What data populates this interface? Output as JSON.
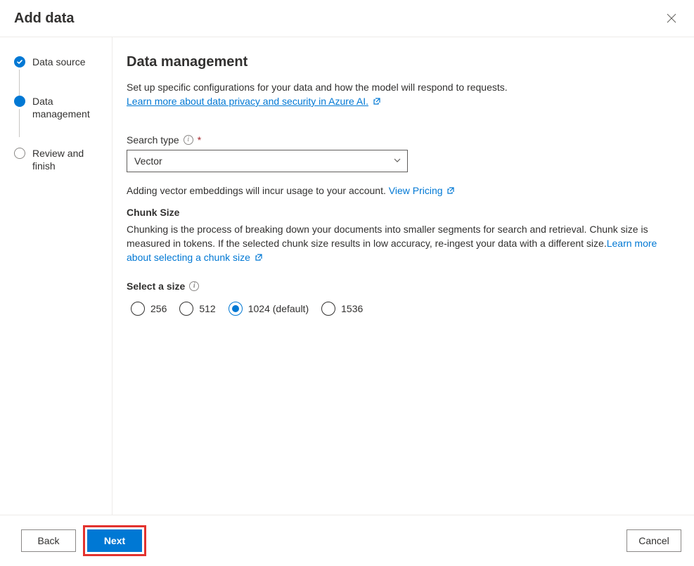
{
  "header": {
    "title": "Add data"
  },
  "sidebar": {
    "steps": [
      {
        "label": "Data source",
        "state": "done"
      },
      {
        "label": "Data management",
        "state": "current"
      },
      {
        "label": "Review and finish",
        "state": "pending"
      }
    ]
  },
  "main": {
    "heading": "Data management",
    "description": "Set up specific configurations for your data and how the model will respond to requests.",
    "learn_more_link": "Learn more about data privacy and security in Azure AI.",
    "search_type": {
      "label": "Search type",
      "required": "*",
      "selected": "Vector"
    },
    "vector_hint_pre": "Adding vector embeddings will incur usage to your account. ",
    "vector_hint_link": "View Pricing",
    "chunk": {
      "heading": "Chunk Size",
      "body_pre": "Chunking is the process of breaking down your documents into smaller segments for search and retrieval. Chunk size is measured in tokens. If the selected chunk size results in low accuracy, re-ingest your data with a different size.",
      "body_link": "Learn more about selecting a chunk size"
    },
    "radio": {
      "label": "Select a size",
      "options": [
        {
          "label": "256",
          "selected": false
        },
        {
          "label": "512",
          "selected": false
        },
        {
          "label": "1024 (default)",
          "selected": true
        },
        {
          "label": "1536",
          "selected": false
        }
      ]
    }
  },
  "footer": {
    "back": "Back",
    "next": "Next",
    "cancel": "Cancel"
  }
}
